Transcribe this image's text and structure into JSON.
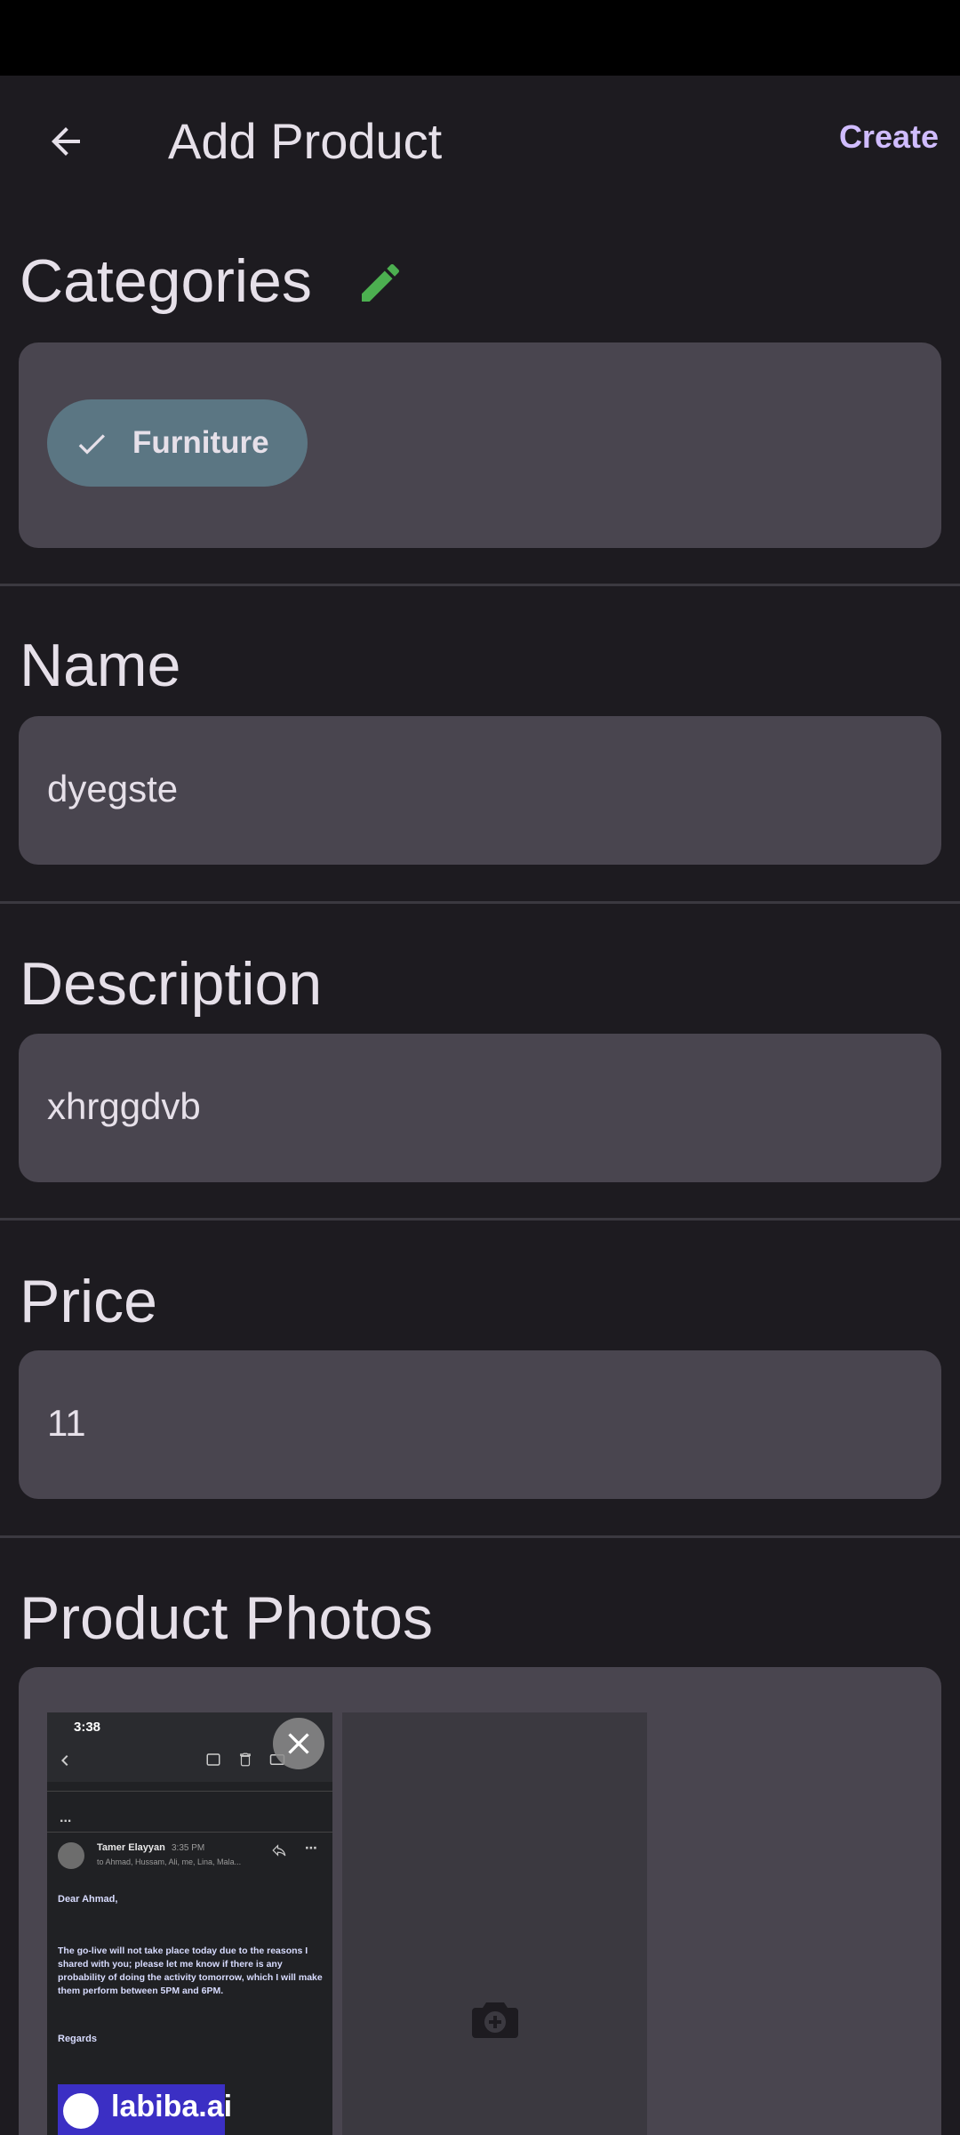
{
  "app_bar": {
    "title": "Add Product",
    "create_label": "Create"
  },
  "categories": {
    "title": "Categories",
    "chips": [
      {
        "label": "Furniture",
        "selected": true
      }
    ]
  },
  "name": {
    "title": "Name",
    "value": "dyegste"
  },
  "description": {
    "title": "Description",
    "value": "xhrggdvb"
  },
  "price": {
    "title": "Price",
    "value": "11"
  },
  "photos": {
    "title": "Product Photos",
    "thumbnail": {
      "time": "3:38",
      "dots": "...",
      "sender": "Tamer Elayyan",
      "sent_time": "3:35 PM",
      "recipients": "to Ahmad, Hussam, Ali, me, Lina, Mala...",
      "greeting": "Dear Ahmad,",
      "body": "The go-live will not take place today due to the reasons I shared with you; please let me know if there is any probability of doing the activity tomorrow, which I will make them perform between 5PM and 6PM.",
      "regards": "Regards",
      "logo_text": "labiba.ai"
    }
  },
  "colors": {
    "background": "#1d1b20",
    "field": "#49454f",
    "accent": "#d0bcff",
    "edit_icon": "#4caf50",
    "chip": "#5b7683"
  }
}
